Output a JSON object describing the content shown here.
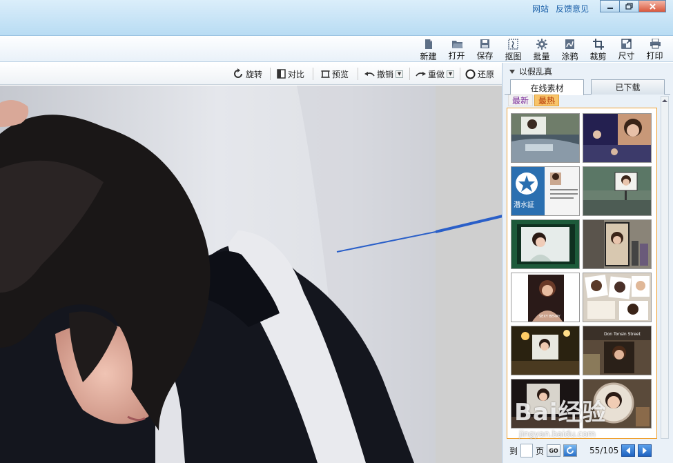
{
  "title_bar": {
    "links": [
      "网站",
      "反馈意见"
    ],
    "window_buttons": [
      "minimize",
      "restore",
      "close"
    ]
  },
  "main_toolbar": {
    "tools": [
      {
        "label": "新建",
        "icon": "new-file-icon"
      },
      {
        "label": "打开",
        "icon": "folder-open-icon"
      },
      {
        "label": "保存",
        "icon": "save-disk-icon"
      },
      {
        "label": "抠图",
        "icon": "cutout-icon"
      },
      {
        "label": "批量",
        "icon": "batch-gear-icon"
      },
      {
        "label": "涂鸦",
        "icon": "doodle-icon"
      },
      {
        "label": "裁剪",
        "icon": "crop-icon"
      },
      {
        "label": "尺寸",
        "icon": "resize-icon"
      },
      {
        "label": "打印",
        "icon": "printer-icon"
      }
    ]
  },
  "edit_toolbar": {
    "rotate": "旋转",
    "compare": "对比",
    "preview": "预览",
    "undo": "撤销",
    "redo": "重做",
    "restore": "还原"
  },
  "panel": {
    "title": "以假乱真",
    "tabs": [
      {
        "label": "在线素材",
        "active": true
      },
      {
        "label": "已下载",
        "active": false
      }
    ],
    "subtabs": [
      {
        "label": "最新",
        "active": false
      },
      {
        "label": "最热",
        "active": true
      }
    ],
    "thumbs": [
      {
        "name": "thumb-stadium-screen",
        "text": ""
      },
      {
        "name": "thumb-concert-crowd",
        "text": ""
      },
      {
        "name": "thumb-diver-id-card",
        "text": "潜水証"
      },
      {
        "name": "thumb-billboard-field",
        "text": ""
      },
      {
        "name": "thumb-green-frame",
        "text": ""
      },
      {
        "name": "thumb-bus-stop-ad",
        "text": ""
      },
      {
        "name": "thumb-magazine-cover",
        "text": "SEXY BERRY"
      },
      {
        "name": "thumb-photo-collage",
        "text": ""
      },
      {
        "name": "thumb-night-city",
        "text": ""
      },
      {
        "name": "thumb-street-sign",
        "text": "Don Tonsin Street"
      },
      {
        "name": "thumb-theater-frame",
        "text": ""
      },
      {
        "name": "thumb-round-frame",
        "text": ""
      }
    ],
    "pager": {
      "to_label": "到",
      "page_label": "页",
      "go_label": "GO",
      "page_count": "55/105"
    }
  },
  "watermark": {
    "text": "Bai经验",
    "sub": "jingyan.baidu.com"
  },
  "colors": {
    "titlebar": "#c6e3f6",
    "accent": "#2a5fc8",
    "hot_tab": "#f8c46a",
    "gallery_border": "#f0a030"
  }
}
